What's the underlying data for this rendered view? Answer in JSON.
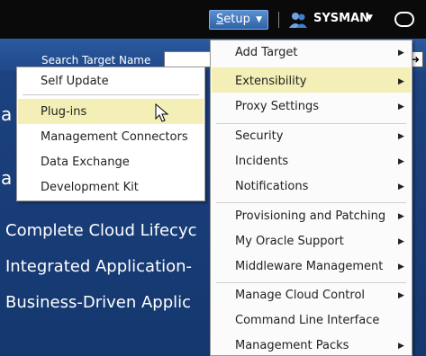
{
  "topbar": {
    "setup_label_prefix": "S",
    "setup_label_rest": "etup",
    "username": "SYSMAN"
  },
  "search": {
    "label": "Search Target Name"
  },
  "hero": {
    "partial_letter_1": "a",
    "partial_letter_2": "a",
    "lines": [
      "Complete Cloud Lifecyc",
      "Integrated Application-",
      "Business-Driven Applic"
    ]
  },
  "plugins_submenu": {
    "items": [
      "Self Update",
      "Plug-ins",
      "Management Connectors",
      "Data Exchange",
      "Development Kit"
    ],
    "highlighted": "Plug-ins"
  },
  "setup_menu": {
    "items": [
      {
        "label": "Add Target",
        "submenu": true
      },
      {
        "label": "Extensibility",
        "submenu": true
      },
      {
        "label": "Proxy Settings",
        "submenu": true
      },
      {
        "label": "Security",
        "submenu": true
      },
      {
        "label": "Incidents",
        "submenu": true
      },
      {
        "label": "Notifications",
        "submenu": true
      },
      {
        "label": "Provisioning and Patching",
        "submenu": true
      },
      {
        "label": "My Oracle Support",
        "submenu": true
      },
      {
        "label": "Middleware Management",
        "submenu": true
      },
      {
        "label": "Manage Cloud Control",
        "submenu": true
      },
      {
        "label": "Command Line Interface",
        "submenu": false
      },
      {
        "label": "Management Packs",
        "submenu": true
      }
    ],
    "highlighted": "Extensibility"
  },
  "colors": {
    "highlight": "#f3efb6",
    "topbar": "#0a0a0a",
    "hero_blue": "#1c4280"
  }
}
